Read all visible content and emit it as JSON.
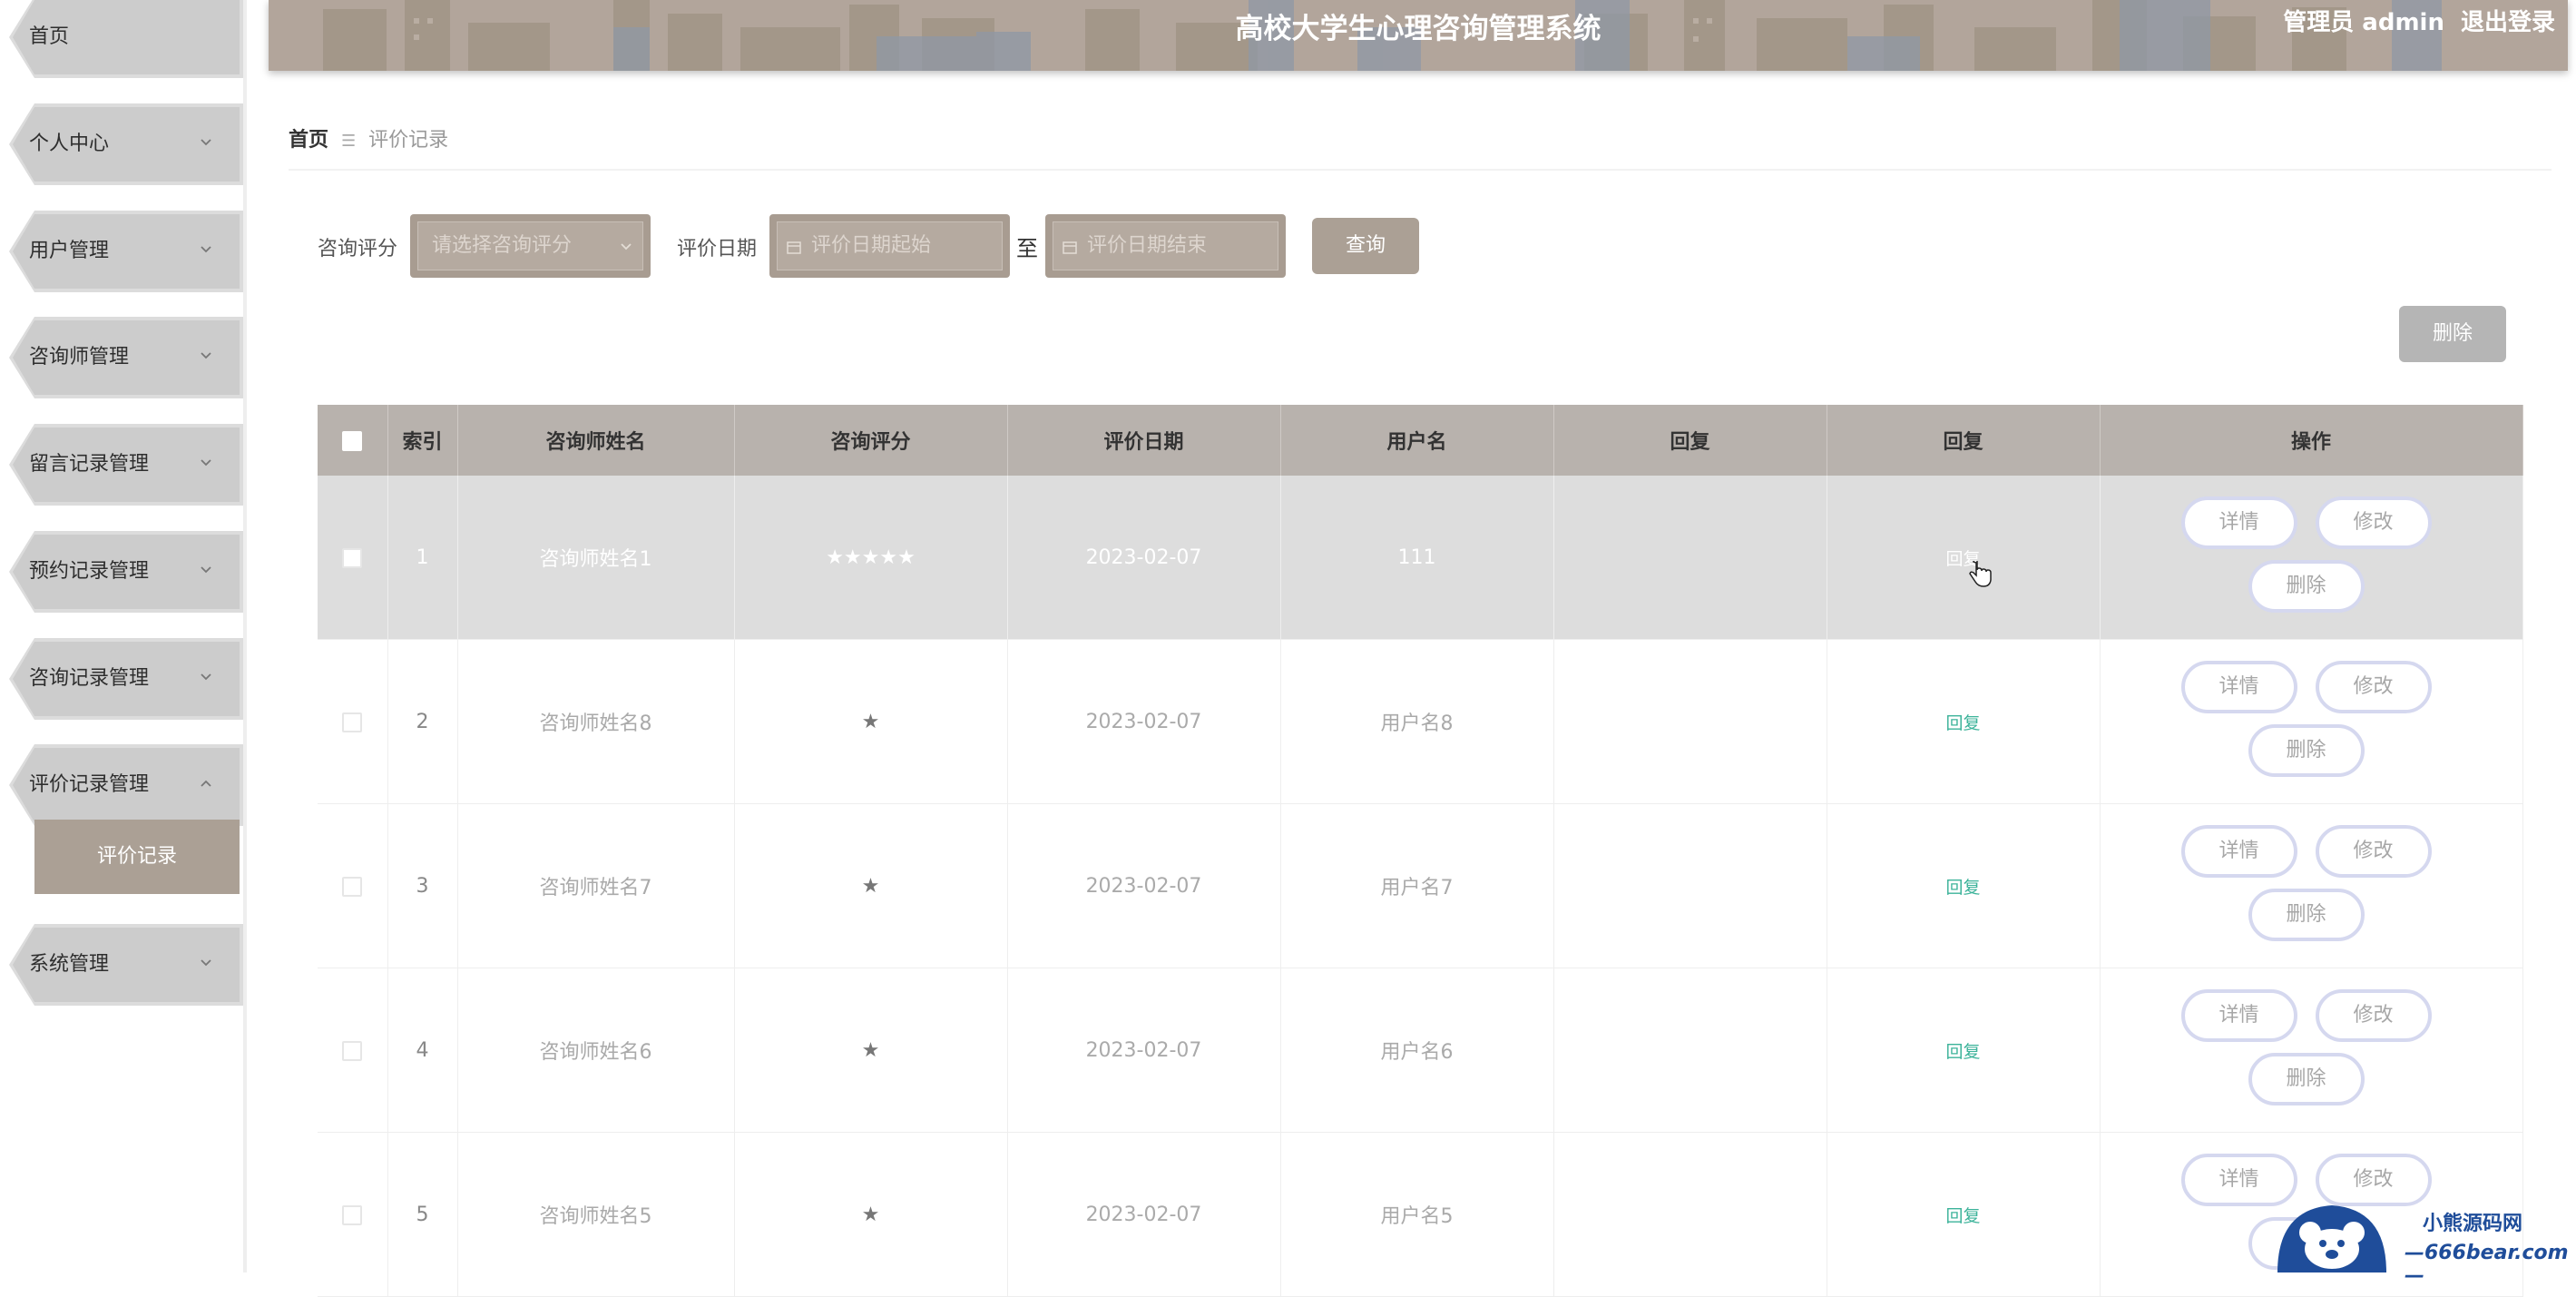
{
  "sidebar": {
    "items": [
      {
        "label": "首页"
      },
      {
        "label": "个人中心"
      },
      {
        "label": "用户管理"
      },
      {
        "label": "咨询师管理"
      },
      {
        "label": "留言记录管理"
      },
      {
        "label": "预约记录管理"
      },
      {
        "label": "咨询记录管理"
      },
      {
        "label": "评价记录管理"
      },
      {
        "label": "系统管理"
      }
    ],
    "active_sub": "评价记录"
  },
  "header": {
    "title": "高校大学生心理咨询管理系统",
    "user": "管理员 admin",
    "logout": "退出登录"
  },
  "breadcrumb": {
    "home": "首页",
    "sep": "☰",
    "current": "评价记录"
  },
  "filter": {
    "score_label": "咨询评分",
    "score_placeholder": "请选择咨询评分",
    "date_label": "评价日期",
    "date_start_placeholder": "评价日期起始",
    "to": "至",
    "date_end_placeholder": "评价日期结束",
    "query_button": "查询"
  },
  "actions": {
    "delete": "删除"
  },
  "table": {
    "headers": [
      "索引",
      "咨询师姓名",
      "咨询评分",
      "评价日期",
      "用户名",
      "回复",
      "回复",
      "操作"
    ],
    "rows": [
      {
        "index": "1",
        "name": "咨询师姓名1",
        "score": "★★★★★",
        "date": "2023-02-07",
        "user": "111",
        "reply_text": "",
        "reply_link": "回复"
      },
      {
        "index": "2",
        "name": "咨询师姓名8",
        "score": "★",
        "date": "2023-02-07",
        "user": "用户名8",
        "reply_text": "",
        "reply_link": "回复"
      },
      {
        "index": "3",
        "name": "咨询师姓名7",
        "score": "★",
        "date": "2023-02-07",
        "user": "用户名7",
        "reply_text": "",
        "reply_link": "回复"
      },
      {
        "index": "4",
        "name": "咨询师姓名6",
        "score": "★",
        "date": "2023-02-07",
        "user": "用户名6",
        "reply_text": "",
        "reply_link": "回复"
      },
      {
        "index": "5",
        "name": "咨询师姓名5",
        "score": "★",
        "date": "2023-02-07",
        "user": "用户名5",
        "reply_text": "",
        "reply_link": "回复"
      }
    ],
    "row_buttons": {
      "detail": "详情",
      "edit": "修改",
      "delete": "删除"
    }
  },
  "watermark": {
    "brand": "小熊源码网",
    "domain": "—666bear.com—"
  },
  "colors": {
    "accent": "#aba095",
    "header": "#b2a59b",
    "link": "#3cb39a",
    "menu": "#cccccc"
  }
}
